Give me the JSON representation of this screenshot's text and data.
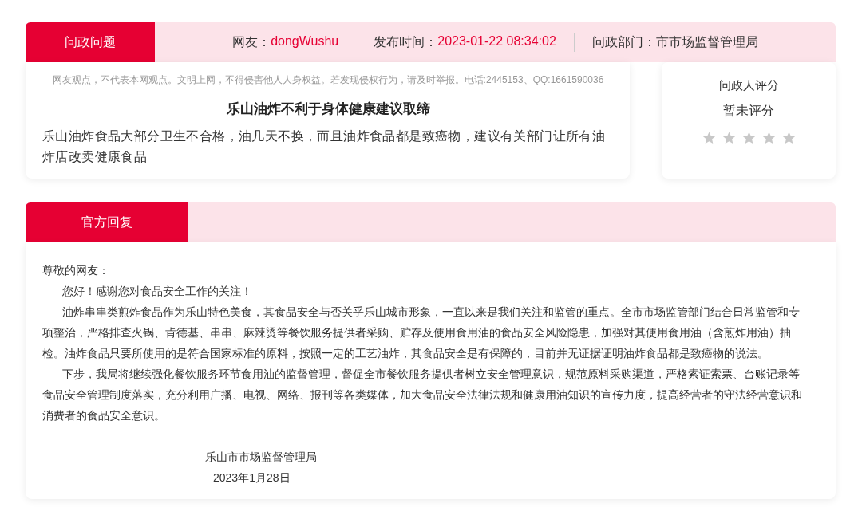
{
  "question_header": {
    "tab": "问政问题",
    "user_label": "网友：",
    "user": "dongWushu",
    "time_label": "发布时间：",
    "time": "2023-01-22 08:34:02",
    "dept_label": "问政部门：",
    "dept": "市市场监督管理局"
  },
  "question": {
    "disclaimer": "网友观点，不代表本网观点。文明上网，不得侵害他人人身权益。若发现侵权行为，请及时举报。电话:2445153、QQ:1661590036",
    "title": "乐山油炸不利于身体健康建议取缔",
    "body": "乐山油炸食品大部分卫生不合格，油几天不换，而且油炸食品都是致癌物，建议有关部门让所有油炸店改卖健康食品"
  },
  "rating": {
    "title": "问政人评分",
    "status": "暂未评分",
    "stars": 0
  },
  "reply_header": {
    "tab": "官方回复"
  },
  "reply": {
    "paragraphs": [
      {
        "kind": "salutation",
        "text": "尊敬的网友："
      },
      {
        "kind": "body",
        "text": "您好！感谢您对食品安全工作的关注！"
      },
      {
        "kind": "body",
        "text": "油炸串串类煎炸食品作为乐山特色美食，其食品安全与否关乎乐山城市形象，一直以来是我们关注和监管的重点。全市市场监管部门结合日常监管和专项整治，严格排查火锅、肯德基、串串、麻辣烫等餐饮服务提供者采购、贮存及使用食用油的食品安全风险隐患，加强对其使用食用油（含煎炸用油）抽检。油炸食品只要所使用的是符合国家标准的原料，按照一定的工艺油炸，其食品安全是有保障的，目前并无证据证明油炸食品都是致癌物的说法。"
      },
      {
        "kind": "body",
        "text": "下步，我局将继续强化餐饮服务环节食用油的监督管理，督促全市餐饮服务提供者树立安全管理意识，规范原料采购渠道，严格索证索票、台账记录等食品安全管理制度落实，充分利用广播、电视、网络、报刊等各类媒体，加大食品安全法律法规和健康用油知识的宣传力度，提高经营者的守法经营意识和消费者的食品安全意识。"
      }
    ],
    "signature": [
      {
        "kind": "org",
        "text": "乐山市市场监督管理局"
      },
      {
        "kind": "date",
        "text": "2023年1月28日"
      }
    ]
  }
}
